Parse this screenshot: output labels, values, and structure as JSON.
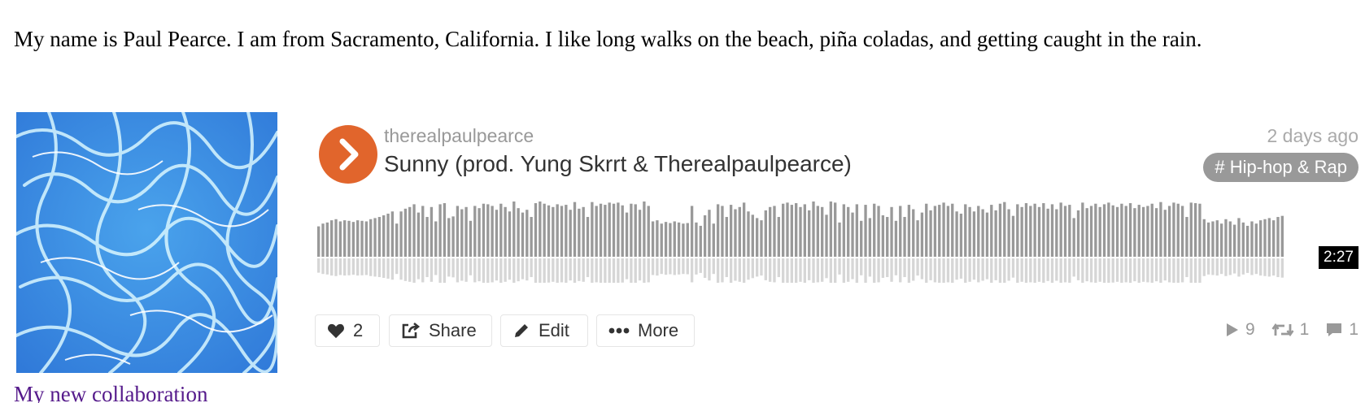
{
  "bio": "My name is Paul Pearce. I am from Sacramento, California. I like long walks on the beach, piña coladas, and getting caught in the rain.",
  "track": {
    "uploader": "therealpaulpearce",
    "title": "Sunny (prod. Yung Skrrt & Therealpaulpearce)",
    "time_ago": "2 days ago",
    "tag": "# Hip-hop & Rap",
    "duration": "2:27",
    "accent_color": "#e1652c",
    "waveform": [
      0.55,
      0.6,
      0.62,
      0.66,
      0.68,
      0.64,
      0.66,
      0.65,
      0.63,
      0.66,
      0.65,
      0.64,
      0.68,
      0.7,
      0.72,
      0.75,
      0.78,
      0.82,
      0.6,
      0.82,
      0.87,
      0.9,
      0.95,
      0.8,
      0.92,
      0.72,
      0.9,
      0.64,
      0.95,
      0.97,
      0.7,
      0.73,
      0.92,
      0.86,
      0.9,
      0.65,
      0.92,
      0.88,
      0.96,
      0.95,
      0.92,
      0.85,
      0.96,
      0.9,
      0.82,
      1.0,
      0.88,
      0.8,
      0.85,
      0.72,
      0.97,
      1.0,
      0.96,
      0.93,
      0.9,
      0.95,
      0.92,
      0.94,
      0.85,
      0.99,
      0.87,
      0.9,
      0.72,
      0.99,
      0.92,
      0.96,
      0.94,
      0.98,
      0.96,
      0.98,
      0.93,
      0.8,
      0.96,
      0.95,
      0.85,
      1.0,
      0.92,
      0.64,
      0.66,
      0.6,
      0.63,
      0.61,
      0.64,
      0.62,
      0.6,
      0.61,
      0.92,
      0.62,
      0.56,
      0.75,
      0.85,
      0.6,
      0.95,
      0.92,
      0.72,
      0.94,
      0.86,
      0.9,
      0.98,
      0.82,
      0.76,
      0.7,
      0.66,
      0.84,
      0.9,
      0.92,
      0.72,
      0.96,
      0.98,
      0.94,
      0.97,
      0.9,
      0.95,
      0.84,
      1.0,
      0.92,
      0.9,
      0.76,
      1.0,
      0.98,
      0.62,
      0.95,
      0.9,
      0.8,
      0.95,
      0.65,
      0.94,
      0.7,
      0.96,
      0.92,
      0.75,
      0.72,
      0.9,
      0.65,
      0.92,
      0.72,
      0.94,
      0.86,
      0.66,
      0.8,
      0.96,
      0.84,
      0.92,
      0.94,
      0.98,
      0.92,
      0.96,
      0.82,
      0.78,
      0.95,
      0.9,
      0.82,
      0.92,
      0.86,
      0.8,
      0.94,
      0.84,
      0.96,
      0.99,
      0.86,
      0.74,
      0.95,
      0.9,
      0.97,
      0.92,
      0.96,
      0.9,
      0.97,
      0.87,
      0.95,
      0.86,
      0.98,
      0.92,
      0.94,
      0.7,
      0.84,
      0.98,
      0.88,
      0.92,
      0.96,
      0.9,
      0.95,
      0.98,
      0.93,
      0.9,
      0.96,
      0.92,
      0.97,
      0.88,
      0.94,
      0.9,
      0.92,
      0.96,
      0.88,
      0.99,
      0.85,
      0.92,
      0.98,
      0.96,
      0.92,
      0.72,
      0.98,
      0.97,
      0.96,
      0.68,
      0.62,
      0.64,
      0.66,
      0.6,
      0.68,
      0.64,
      0.58,
      0.7,
      0.62,
      0.56,
      0.64,
      0.6,
      0.66,
      0.68,
      0.7,
      0.66,
      0.72,
      0.74
    ]
  },
  "actions": {
    "like_count": "2",
    "share_label": "Share",
    "edit_label": "Edit",
    "more_label": "More"
  },
  "stats": {
    "plays": "9",
    "reposts": "1",
    "comments": "1"
  },
  "caption": "My new collaboration"
}
